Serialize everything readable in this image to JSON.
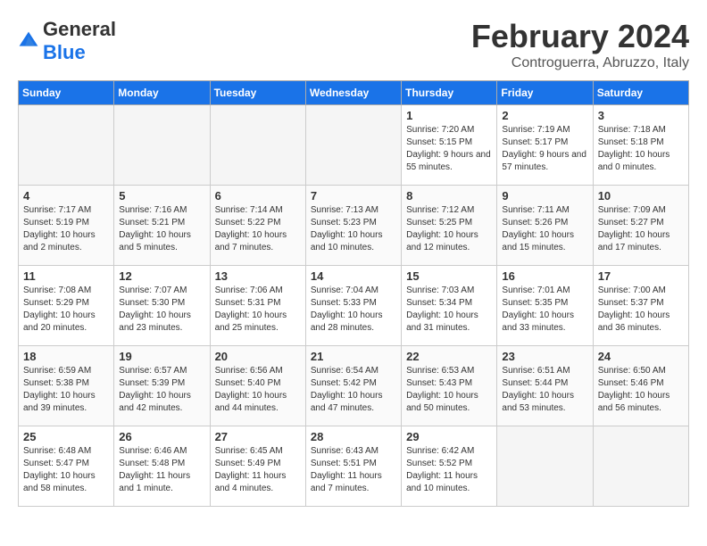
{
  "header": {
    "logo_general": "General",
    "logo_blue": "Blue",
    "month_title": "February 2024",
    "location": "Controguerra, Abruzzo, Italy"
  },
  "days_of_week": [
    "Sunday",
    "Monday",
    "Tuesday",
    "Wednesday",
    "Thursday",
    "Friday",
    "Saturday"
  ],
  "weeks": [
    [
      {
        "day": "",
        "empty": true
      },
      {
        "day": "",
        "empty": true
      },
      {
        "day": "",
        "empty": true
      },
      {
        "day": "",
        "empty": true
      },
      {
        "day": "1",
        "sunrise": "Sunrise: 7:20 AM",
        "sunset": "Sunset: 5:15 PM",
        "daylight": "Daylight: 9 hours and 55 minutes."
      },
      {
        "day": "2",
        "sunrise": "Sunrise: 7:19 AM",
        "sunset": "Sunset: 5:17 PM",
        "daylight": "Daylight: 9 hours and 57 minutes."
      },
      {
        "day": "3",
        "sunrise": "Sunrise: 7:18 AM",
        "sunset": "Sunset: 5:18 PM",
        "daylight": "Daylight: 10 hours and 0 minutes."
      }
    ],
    [
      {
        "day": "4",
        "sunrise": "Sunrise: 7:17 AM",
        "sunset": "Sunset: 5:19 PM",
        "daylight": "Daylight: 10 hours and 2 minutes."
      },
      {
        "day": "5",
        "sunrise": "Sunrise: 7:16 AM",
        "sunset": "Sunset: 5:21 PM",
        "daylight": "Daylight: 10 hours and 5 minutes."
      },
      {
        "day": "6",
        "sunrise": "Sunrise: 7:14 AM",
        "sunset": "Sunset: 5:22 PM",
        "daylight": "Daylight: 10 hours and 7 minutes."
      },
      {
        "day": "7",
        "sunrise": "Sunrise: 7:13 AM",
        "sunset": "Sunset: 5:23 PM",
        "daylight": "Daylight: 10 hours and 10 minutes."
      },
      {
        "day": "8",
        "sunrise": "Sunrise: 7:12 AM",
        "sunset": "Sunset: 5:25 PM",
        "daylight": "Daylight: 10 hours and 12 minutes."
      },
      {
        "day": "9",
        "sunrise": "Sunrise: 7:11 AM",
        "sunset": "Sunset: 5:26 PM",
        "daylight": "Daylight: 10 hours and 15 minutes."
      },
      {
        "day": "10",
        "sunrise": "Sunrise: 7:09 AM",
        "sunset": "Sunset: 5:27 PM",
        "daylight": "Daylight: 10 hours and 17 minutes."
      }
    ],
    [
      {
        "day": "11",
        "sunrise": "Sunrise: 7:08 AM",
        "sunset": "Sunset: 5:29 PM",
        "daylight": "Daylight: 10 hours and 20 minutes."
      },
      {
        "day": "12",
        "sunrise": "Sunrise: 7:07 AM",
        "sunset": "Sunset: 5:30 PM",
        "daylight": "Daylight: 10 hours and 23 minutes."
      },
      {
        "day": "13",
        "sunrise": "Sunrise: 7:06 AM",
        "sunset": "Sunset: 5:31 PM",
        "daylight": "Daylight: 10 hours and 25 minutes."
      },
      {
        "day": "14",
        "sunrise": "Sunrise: 7:04 AM",
        "sunset": "Sunset: 5:33 PM",
        "daylight": "Daylight: 10 hours and 28 minutes."
      },
      {
        "day": "15",
        "sunrise": "Sunrise: 7:03 AM",
        "sunset": "Sunset: 5:34 PM",
        "daylight": "Daylight: 10 hours and 31 minutes."
      },
      {
        "day": "16",
        "sunrise": "Sunrise: 7:01 AM",
        "sunset": "Sunset: 5:35 PM",
        "daylight": "Daylight: 10 hours and 33 minutes."
      },
      {
        "day": "17",
        "sunrise": "Sunrise: 7:00 AM",
        "sunset": "Sunset: 5:37 PM",
        "daylight": "Daylight: 10 hours and 36 minutes."
      }
    ],
    [
      {
        "day": "18",
        "sunrise": "Sunrise: 6:59 AM",
        "sunset": "Sunset: 5:38 PM",
        "daylight": "Daylight: 10 hours and 39 minutes."
      },
      {
        "day": "19",
        "sunrise": "Sunrise: 6:57 AM",
        "sunset": "Sunset: 5:39 PM",
        "daylight": "Daylight: 10 hours and 42 minutes."
      },
      {
        "day": "20",
        "sunrise": "Sunrise: 6:56 AM",
        "sunset": "Sunset: 5:40 PM",
        "daylight": "Daylight: 10 hours and 44 minutes."
      },
      {
        "day": "21",
        "sunrise": "Sunrise: 6:54 AM",
        "sunset": "Sunset: 5:42 PM",
        "daylight": "Daylight: 10 hours and 47 minutes."
      },
      {
        "day": "22",
        "sunrise": "Sunrise: 6:53 AM",
        "sunset": "Sunset: 5:43 PM",
        "daylight": "Daylight: 10 hours and 50 minutes."
      },
      {
        "day": "23",
        "sunrise": "Sunrise: 6:51 AM",
        "sunset": "Sunset: 5:44 PM",
        "daylight": "Daylight: 10 hours and 53 minutes."
      },
      {
        "day": "24",
        "sunrise": "Sunrise: 6:50 AM",
        "sunset": "Sunset: 5:46 PM",
        "daylight": "Daylight: 10 hours and 56 minutes."
      }
    ],
    [
      {
        "day": "25",
        "sunrise": "Sunrise: 6:48 AM",
        "sunset": "Sunset: 5:47 PM",
        "daylight": "Daylight: 10 hours and 58 minutes."
      },
      {
        "day": "26",
        "sunrise": "Sunrise: 6:46 AM",
        "sunset": "Sunset: 5:48 PM",
        "daylight": "Daylight: 11 hours and 1 minute."
      },
      {
        "day": "27",
        "sunrise": "Sunrise: 6:45 AM",
        "sunset": "Sunset: 5:49 PM",
        "daylight": "Daylight: 11 hours and 4 minutes."
      },
      {
        "day": "28",
        "sunrise": "Sunrise: 6:43 AM",
        "sunset": "Sunset: 5:51 PM",
        "daylight": "Daylight: 11 hours and 7 minutes."
      },
      {
        "day": "29",
        "sunrise": "Sunrise: 6:42 AM",
        "sunset": "Sunset: 5:52 PM",
        "daylight": "Daylight: 11 hours and 10 minutes."
      },
      {
        "day": "",
        "empty": true
      },
      {
        "day": "",
        "empty": true
      }
    ]
  ]
}
